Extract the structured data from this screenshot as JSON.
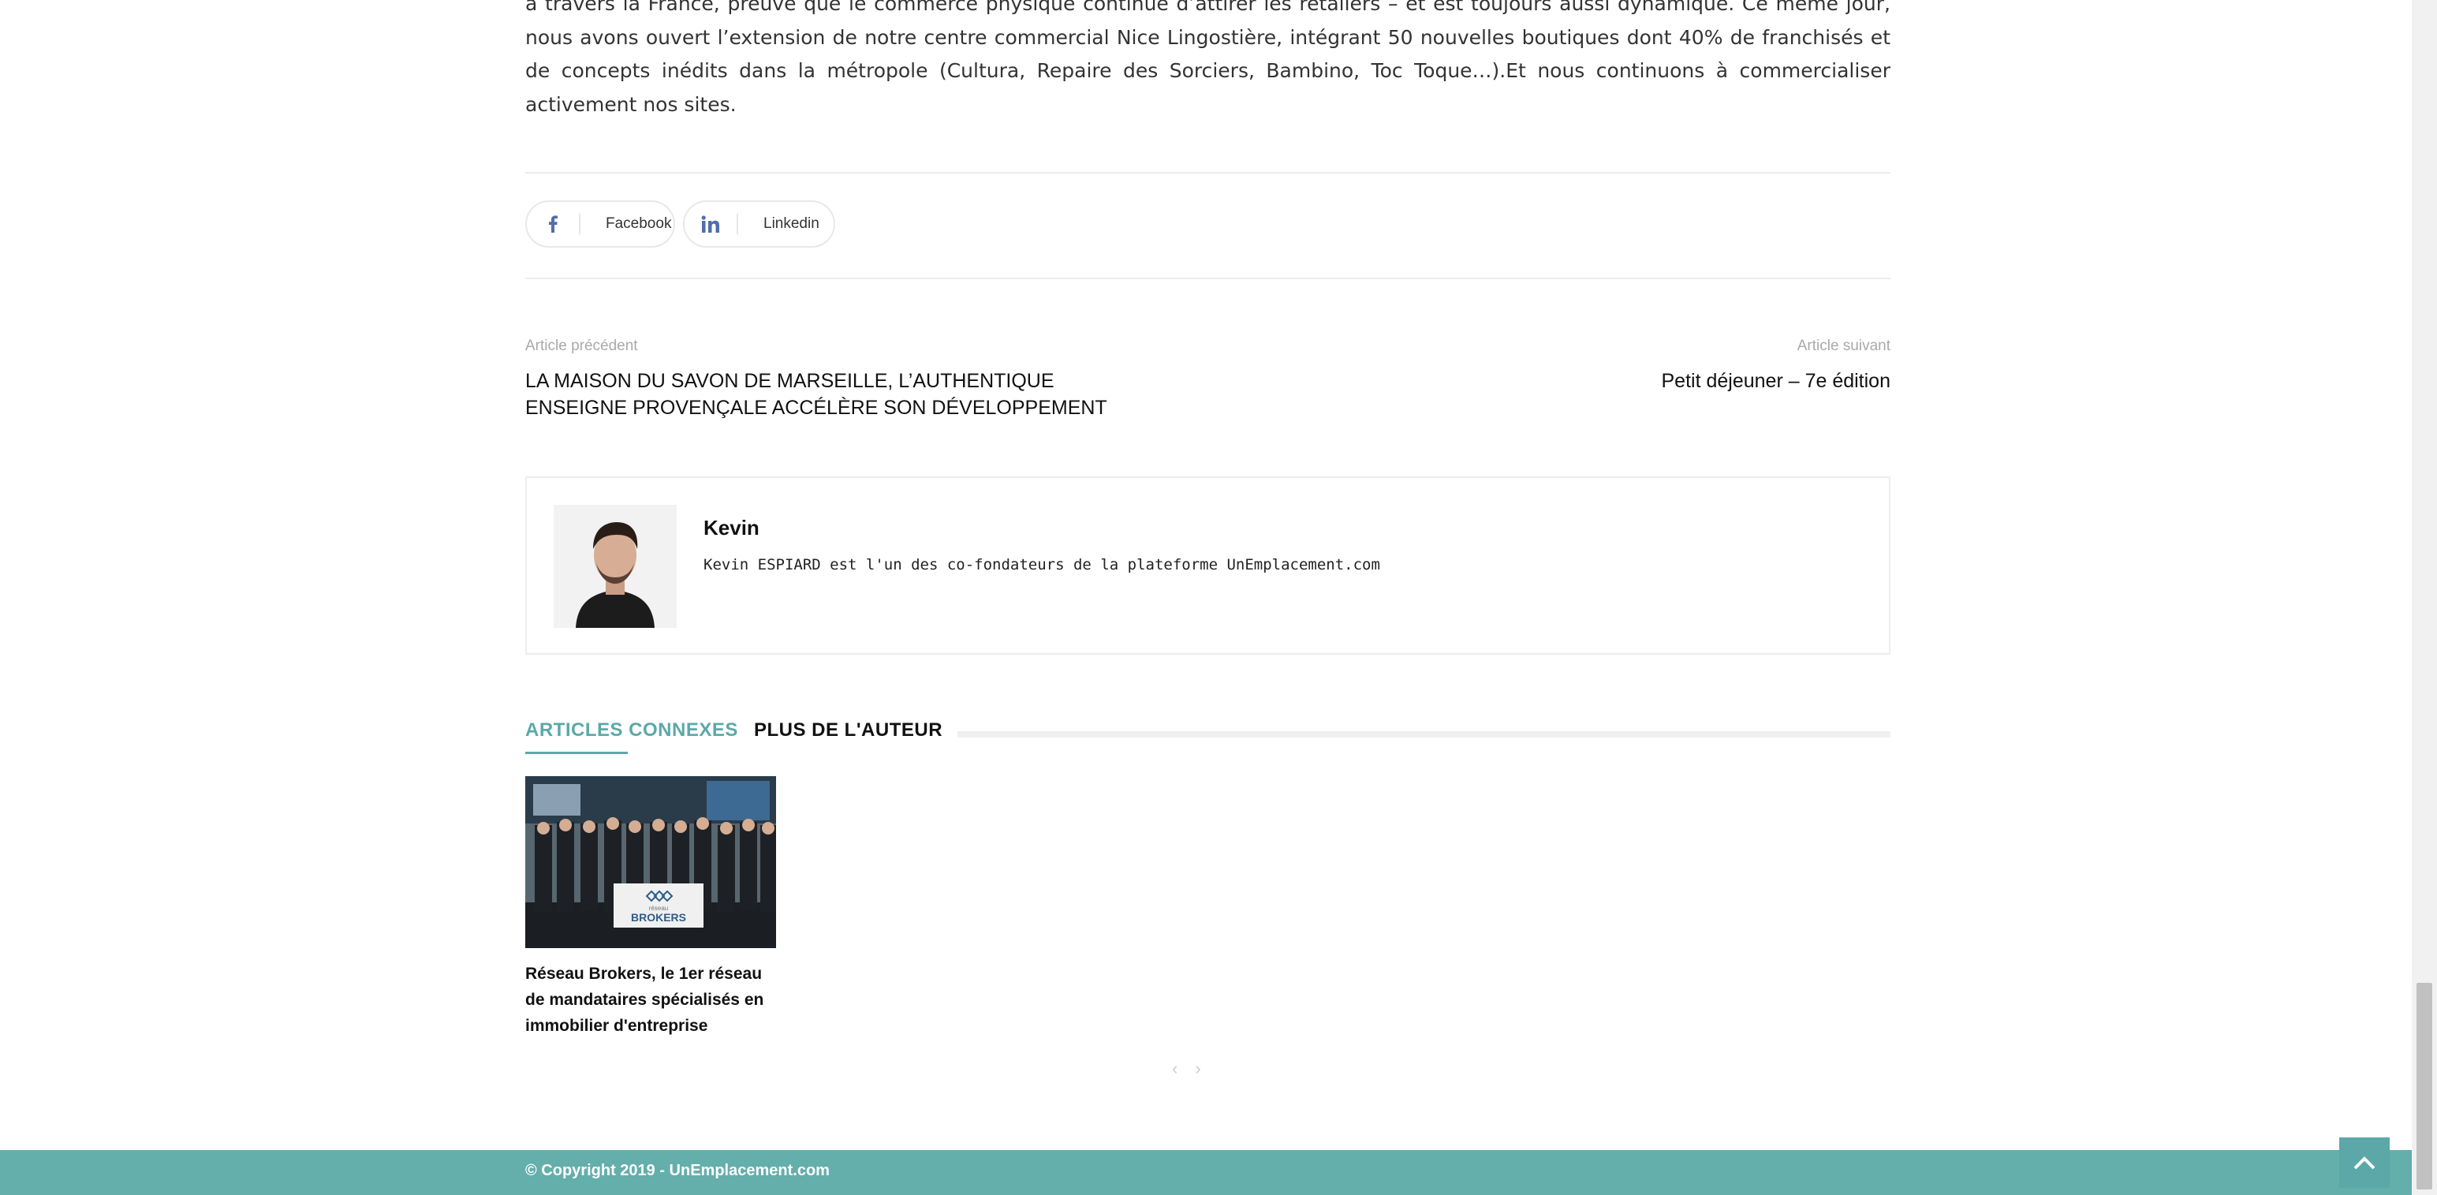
{
  "article": {
    "paragraph_end": "à travers la France, preuve que le commerce physique continue d’attirer les retailers – et est toujours aussi dynamique. Ce même jour, nous avons ouvert l’extension de notre centre commercial Nice Lingostière, intégrant 50 nouvelles boutiques dont 40% de franchisés et de concepts inédits dans la métropole (Cultura, Repaire des Sorciers, Bambino, Toc Toque…).Et nous continuons à commercialiser activement nos sites."
  },
  "share": {
    "facebook_label": "Facebook",
    "linkedin_label": "Linkedin"
  },
  "nav": {
    "prev_label": "Article précédent",
    "prev_title": "LA MAISON DU SAVON DE MARSEILLE, L’AUTHENTIQUE ENSEIGNE PROVENÇALE ACCÉLÈRE SON DÉVELOPPEMENT",
    "next_label": "Article suivant",
    "next_title": "Petit déjeuner – 7e édition"
  },
  "author": {
    "name": "Kevin",
    "description": "Kevin ESPIARD est l'un des co-fondateurs de la plateforme UnEmplacement.com"
  },
  "related": {
    "tabs": [
      "ARTICLES CONNEXES",
      "PLUS DE L'AUTEUR"
    ],
    "cards": [
      {
        "title": "Réseau Brokers, le 1er réseau de mandataires spécialisés en immobilier d'entreprise",
        "image_sign_top": "réseau",
        "image_sign": "BROKERS"
      }
    ],
    "pager_prev": "‹",
    "pager_next": "›"
  },
  "footer": {
    "copyright": "© Copyright 2019 - UnEmplacement.com"
  },
  "colors": {
    "accent": "#5ca8a9",
    "footer": "#64aeab",
    "share_icon": "#516eab"
  }
}
